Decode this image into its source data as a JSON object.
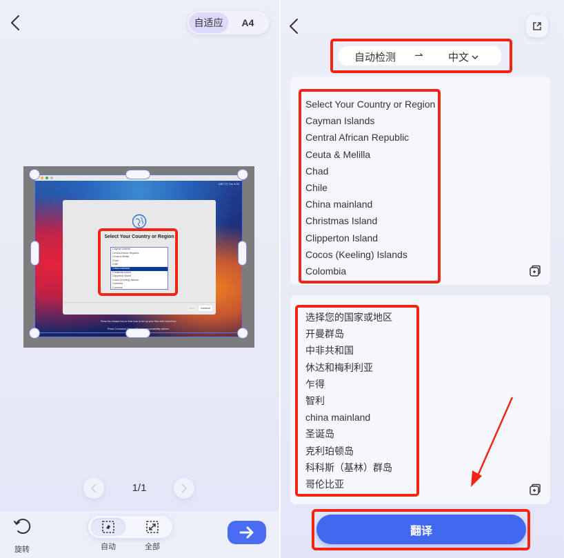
{
  "left_panel": {
    "size_toggle": {
      "options": [
        "自适应",
        "A4"
      ],
      "selected": "自适应"
    },
    "preview": {
      "mac_status": "ABC 口  Tue 4:34",
      "dialog_title": "Select Your Country or Region",
      "list_items": [
        "Cayman Islands",
        "Central African Republic",
        "Ceuta & Melilla",
        "Chad",
        "Chile",
        "China mainland",
        "Christmas Island",
        "Clipperton Island",
        "Cocos (Keeling) Islands",
        "Colombia",
        "Comoros"
      ],
      "selected_item": "China mainland",
      "back_button": "Back",
      "continue_button": "Continue",
      "hint_1": "Press the escape key to hear how to set up your Mac with VoiceOver.",
      "hint_2": "Press Command-Option-F5 to view accessibility options."
    },
    "pager": {
      "current": 1,
      "total": 1,
      "label": "1/1"
    },
    "toolbar": {
      "rotate_label": "旋转",
      "auto_label": "自动",
      "full_label": "全部",
      "selected_mode": "自动"
    },
    "colors": {
      "accent": "#4a6cf0",
      "annotation": "#f22515"
    }
  },
  "right_panel": {
    "language": {
      "source": "自动检测",
      "arrow": "⇀",
      "target": "中文"
    },
    "source_lines": [
      "Select Your Country or Region",
      "Cayman Islands",
      "Central African Republic",
      "Ceuta & Melilla",
      "Chad",
      "Chile",
      "China mainland",
      "Christmas Island",
      "Clipperton Island",
      "Cocos (Keeling) Islands",
      "Colombia"
    ],
    "translated_lines": [
      "选择您的国家或地区",
      "开曼群岛",
      "中非共和国",
      "休达和梅利利亚",
      "乍得",
      "智利",
      "china mainland",
      "圣诞岛",
      "克利珀顿岛",
      "科科斯（基林）群岛",
      "哥伦比亚"
    ],
    "translate_button": "翻译",
    "colors": {
      "button": "#4169f0"
    }
  }
}
